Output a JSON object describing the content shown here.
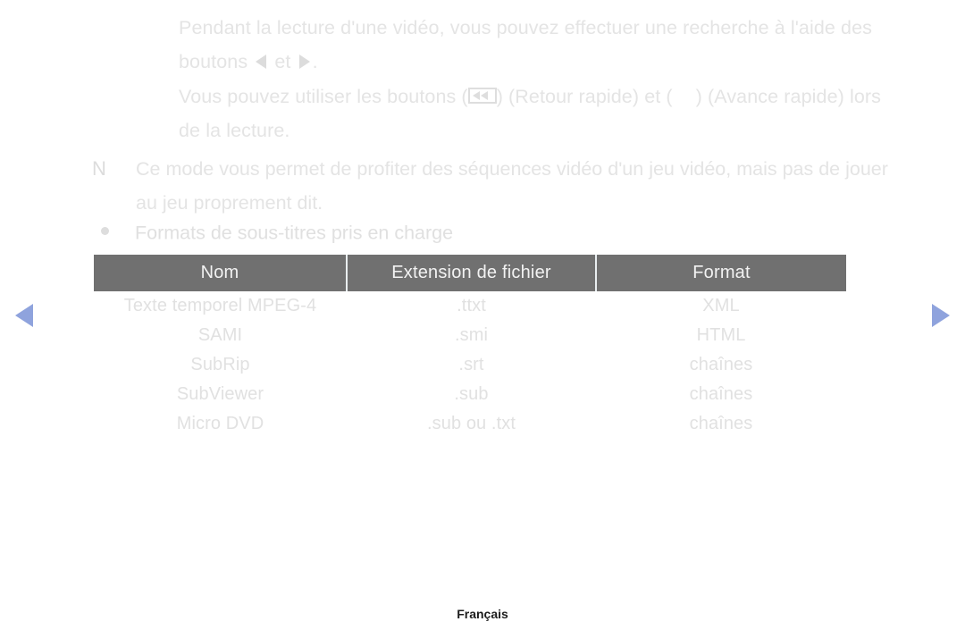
{
  "page": {
    "language_footer": "Français",
    "accent_arrow_color": "#8fa3dd",
    "body_text_color": "#e4e4e4",
    "table_header_bg": "#707070"
  },
  "paragraphs": {
    "p1_part1": "Pendant la lecture d'une vidéo, vous pouvez effectuer une recherche à l'aide des boutons ",
    "p1_mid": " et ",
    "p1_end": ".",
    "p2_part1": "Vous pouvez utiliser les boutons (",
    "p2_part2": ") (Retour rapide) et (",
    "p2_part3": ") (Avance rapide) lors de la lecture."
  },
  "note": {
    "marker": "N",
    "text": "Ce mode vous permet de profiter des séquences vidéo d'un jeu vidéo, mais pas de jouer au jeu proprement dit."
  },
  "bullet": {
    "label": "Formats de sous-titres pris en charge"
  },
  "table": {
    "headers": [
      "Nom",
      "Extension de fichier",
      "Format"
    ],
    "rows": [
      [
        "Texte temporel MPEG-4",
        ".ttxt",
        "XML"
      ],
      [
        "SAMI",
        ".smi",
        "HTML"
      ],
      [
        "SubRip",
        ".srt",
        "chaînes"
      ],
      [
        "SubViewer",
        ".sub",
        "chaînes"
      ],
      [
        "Micro DVD",
        ".sub ou .txt",
        "chaînes"
      ]
    ]
  },
  "nav": {
    "prev_label": "Page précédente",
    "next_label": "Page suivante"
  }
}
